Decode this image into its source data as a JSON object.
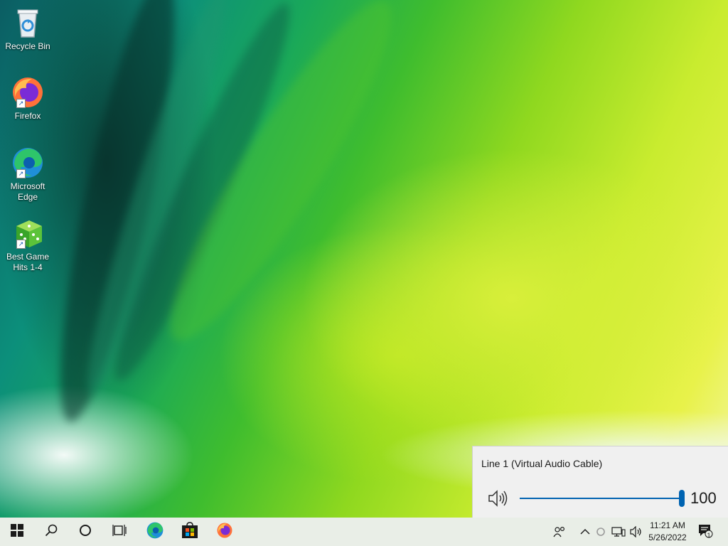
{
  "desktop": {
    "icons": [
      {
        "label": "Recycle Bin",
        "icon": "recycle-bin-icon"
      },
      {
        "label": "Firefox",
        "icon": "firefox-icon"
      },
      {
        "label": "Microsoft Edge",
        "icon": "edge-icon"
      },
      {
        "label": "Best Game Hits 1-4",
        "icon": "dice-icon"
      }
    ]
  },
  "volume_flyout": {
    "device_name": "Line 1 (Virtual Audio Cable)",
    "volume": "100",
    "volume_fraction": 1.0,
    "accent_color": "#0063b1"
  },
  "taskbar": {
    "pinned": [
      "start-icon",
      "search-icon",
      "cortana-icon",
      "task-view-icon",
      "edge-icon",
      "store-icon",
      "firefox-icon"
    ],
    "tray": [
      "people-icon",
      "chevron-up-icon",
      "status-ring-icon",
      "network-icon",
      "speaker-icon"
    ],
    "clock_time": "11:21 AM",
    "clock_date": "5/26/2022",
    "notification_count": "1"
  }
}
